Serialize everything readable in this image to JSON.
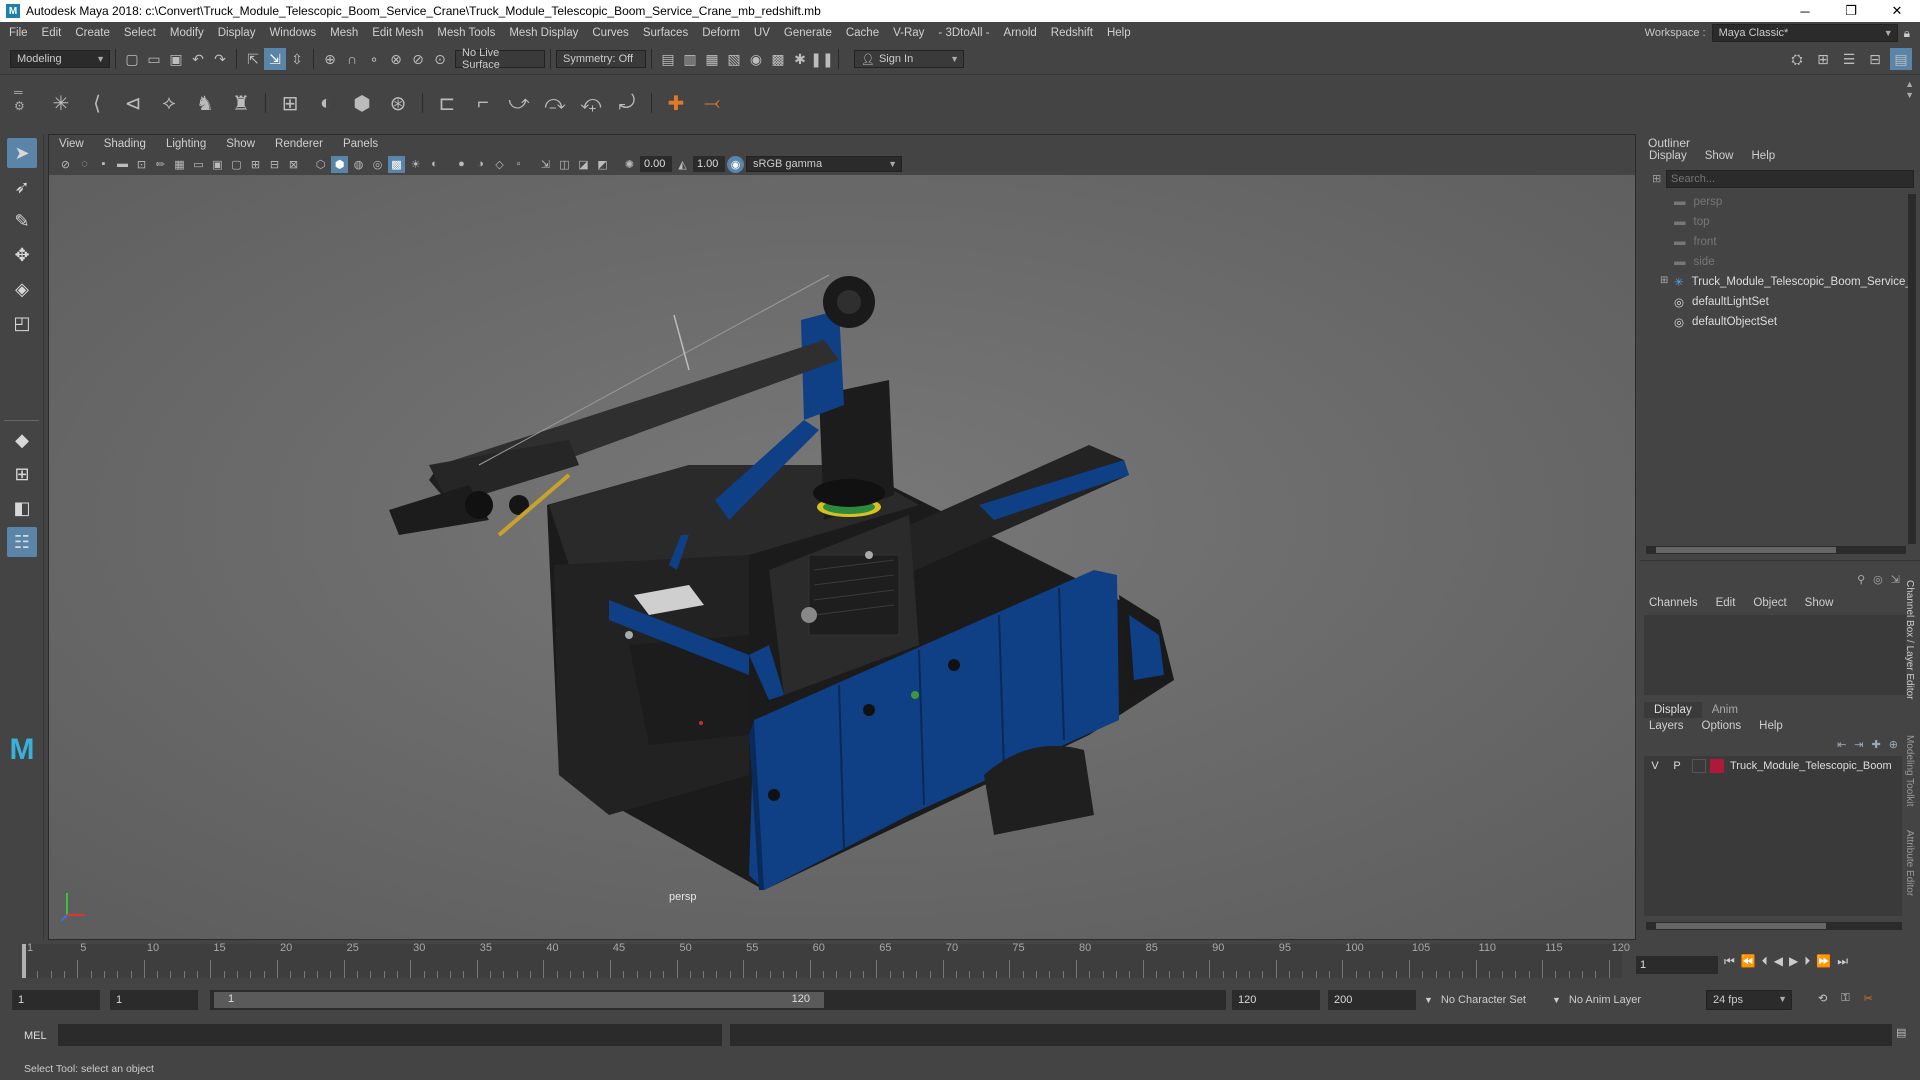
{
  "window": {
    "title": "Autodesk Maya 2018: c:\\Convert\\Truck_Module_Telescopic_Boom_Service_Crane\\Truck_Module_Telescopic_Boom_Service_Crane_mb_redshift.mb",
    "minimize": "─",
    "maximize": "❐",
    "close": "✕"
  },
  "menubar": {
    "items": [
      "File",
      "Edit",
      "Create",
      "Select",
      "Modify",
      "Display",
      "Windows",
      "Mesh",
      "Edit Mesh",
      "Mesh Tools",
      "Mesh Display",
      "Curves",
      "Surfaces",
      "Deform",
      "UV",
      "Generate",
      "Cache",
      "V-Ray",
      "- 3DtoAll -",
      "Arnold",
      "Redshift",
      "Help"
    ],
    "workspace_label": "Workspace :",
    "workspace_value": "Maya Classic*"
  },
  "statusline": {
    "mode": "Modeling",
    "live_surface": "No Live Surface",
    "symmetry": "Symmetry: Off",
    "sign_in": "Sign In"
  },
  "viewport": {
    "menu": [
      "View",
      "Shading",
      "Lighting",
      "Show",
      "Renderer",
      "Panels"
    ],
    "exposure": "0.00",
    "gamma": "1.00",
    "color_space": "sRGB gamma",
    "camera_label": "persp"
  },
  "outliner": {
    "title": "Outliner",
    "menu": [
      "Display",
      "Show",
      "Help"
    ],
    "search_placeholder": "Search...",
    "items": [
      {
        "label": "persp",
        "type": "camera",
        "dim": true
      },
      {
        "label": "top",
        "type": "camera",
        "dim": true
      },
      {
        "label": "front",
        "type": "camera",
        "dim": true
      },
      {
        "label": "side",
        "type": "camera",
        "dim": true
      },
      {
        "label": "Truck_Module_Telescopic_Boom_Service_",
        "type": "group",
        "dim": false
      },
      {
        "label": "defaultLightSet",
        "type": "set",
        "dim": false
      },
      {
        "label": "defaultObjectSet",
        "type": "set",
        "dim": false
      }
    ]
  },
  "channelbox": {
    "menu": [
      "Channels",
      "Edit",
      "Object",
      "Show"
    ]
  },
  "layereditor": {
    "tabs": [
      "Display",
      "Anim"
    ],
    "menu": [
      "Layers",
      "Options",
      "Help"
    ],
    "layer": {
      "v": "V",
      "p": "P",
      "name": "Truck_Module_Telescopic_Boom",
      "color": "#b0183a"
    }
  },
  "side_tabs": [
    "Channel Box / Layer Editor",
    "Modeling Toolkit",
    "Attribute Editor"
  ],
  "timeline": {
    "ticks": [
      "1",
      "5",
      "10",
      "15",
      "20",
      "25",
      "30",
      "35",
      "40",
      "45",
      "50",
      "55",
      "60",
      "65",
      "70",
      "75",
      "80",
      "85",
      "90",
      "95",
      "100",
      "105",
      "110",
      "115",
      "120"
    ],
    "current_frame": "1"
  },
  "range": {
    "start": "1",
    "anim_start": "1",
    "slider_start": "1",
    "slider_end": "120",
    "anim_end": "120",
    "end": "200",
    "character_set": "No Character Set",
    "anim_layer": "No Anim Layer",
    "fps": "24 fps"
  },
  "cmdline": {
    "label": "MEL"
  },
  "helpline": {
    "text": "Select Tool: select an object"
  },
  "colors": {
    "accent": "#5b85a8",
    "truck_blue": "#0d3f86",
    "viewport_bg": "#6f6f6f"
  }
}
